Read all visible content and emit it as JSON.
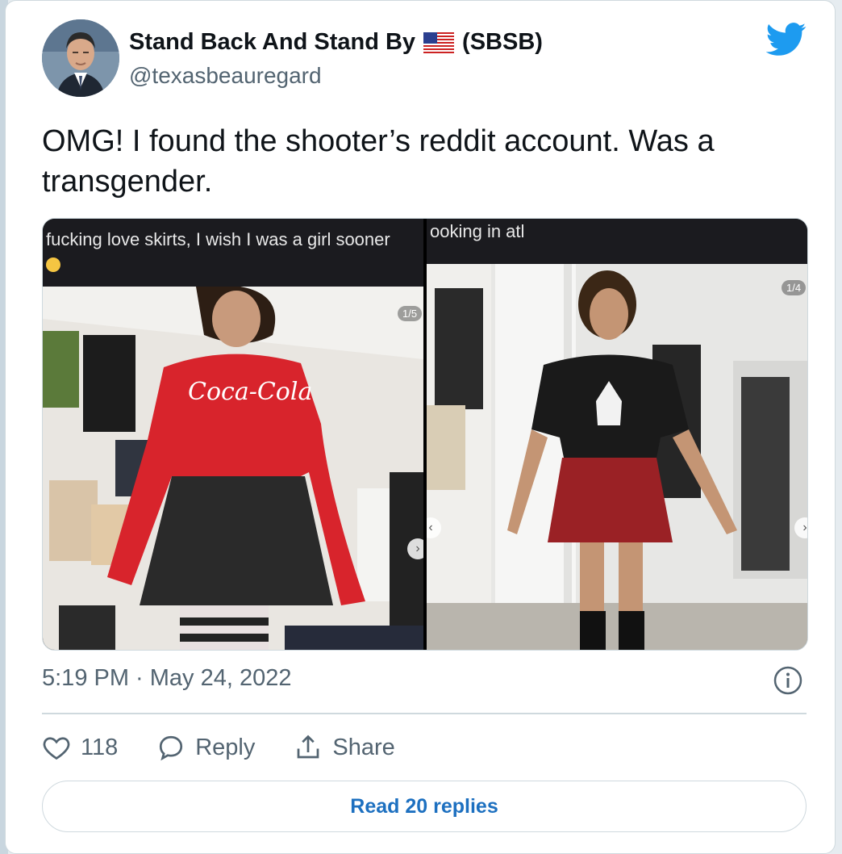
{
  "author": {
    "display_name": "Stand Back And Stand By",
    "name_suffix": "(SBSB)",
    "handle": "@texasbeauregard",
    "flag_icon": "us-flag-icon"
  },
  "tweet": {
    "text": "OMG! I found the shooter’s reddit account. Was a transgender.",
    "timestamp": "5:19 PM · May 24, 2022"
  },
  "media": {
    "left": {
      "caption": "fucking love skirts, I wish I was a girl sooner",
      "counter": "1/5"
    },
    "right": {
      "caption": "ooking in atl",
      "counter": "1/4"
    }
  },
  "actions": {
    "like_count": "118",
    "reply_label": "Reply",
    "share_label": "Share"
  },
  "read_replies_label": "Read 20 replies",
  "colors": {
    "twitter_blue": "#1d9bf0",
    "link_blue": "#1d70c0",
    "text": "#0f1419",
    "secondary_text": "#536471"
  }
}
